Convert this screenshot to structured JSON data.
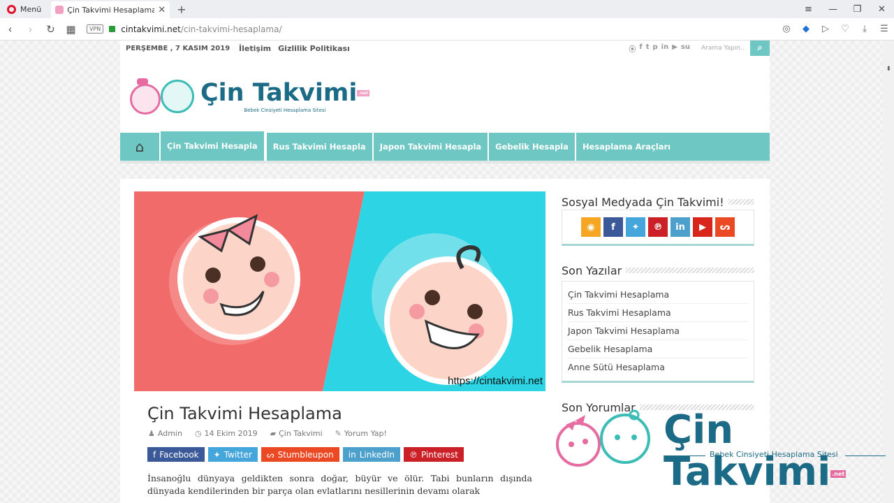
{
  "browser": {
    "menu_label": "Menü",
    "tab_title": "Çin Takvimi Hesaplama | Çin",
    "vpn_label": "VPN",
    "url_domain": "cintakvimi.net",
    "url_path": "/cin-takvimi-hesaplama/"
  },
  "topbar": {
    "date": "PERŞEMBE , 7 KASIM 2019",
    "links": [
      "İletişim",
      "Gizlilik Politikası"
    ],
    "search_placeholder": "Arama Yapın.."
  },
  "logo": {
    "title": "Çin Takvimi",
    "subtitle": "Bebek Cinsiyeti Hesaplama Sitesi",
    "tld": ".net"
  },
  "menu": {
    "items": [
      "Çin Takvimi Hesapla",
      "Rus Takvimi Hesapla",
      "Japon Takvimi Hesapla",
      "Gebelik Hesapla",
      "Hesaplama Araçları"
    ]
  },
  "post": {
    "image_caption": "https://cintakvimi.net",
    "title": "Çin Takvimi Hesaplama",
    "author": "Admin",
    "date": "14 Ekim 2019",
    "category": "Çin Takvimi",
    "comment": "Yorum Yap!",
    "share": [
      "Facebook",
      "Twitter",
      "Stumbleupon",
      "LinkedIn",
      "Pinterest"
    ],
    "excerpt": "İnsanoğlu dünyaya geldikten sonra doğar, büyür ve ölür. Tabi bunların dışında dünyada kendilerinden bir parça olan evlatlarını nesillerinin devamı olarak"
  },
  "sidebar": {
    "social_title": "Sosyal Medyada Çin Takvimi!",
    "recent_title": "Son Yazılar",
    "recent_posts": [
      "Çin Takvimi Hesaplama",
      "Rus Takvimi Hesaplama",
      "Japon Takvimi Hesaplama",
      "Gebelik Hesaplama",
      "Anne Sütü Hesaplama"
    ],
    "comments_title": "Son Yorumlar"
  },
  "colors": {
    "accent": "#6ec7c3",
    "brand": "#1c6b86",
    "pink": "#f26b6b",
    "cyan": "#2dd4e4"
  },
  "watermark": {
    "title": "Çin Takvimi",
    "subtitle": "Bebek Cinsiyeti Hesaplama Sitesi",
    "tld": ".net"
  }
}
